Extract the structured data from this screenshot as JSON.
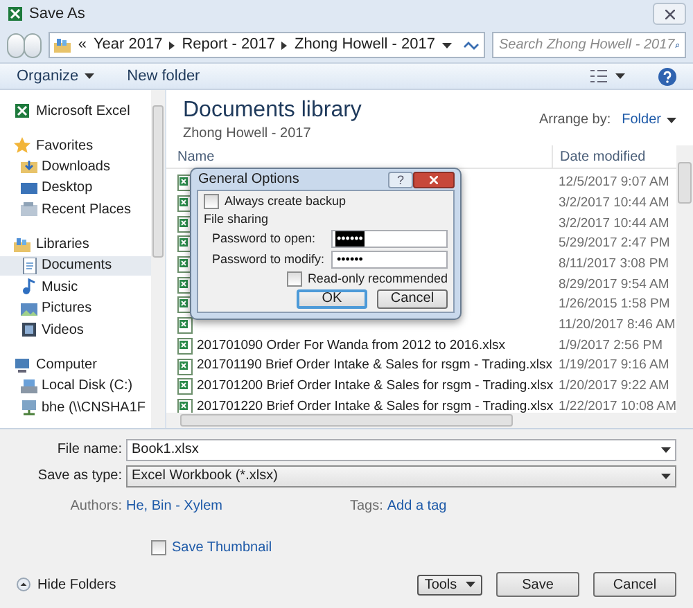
{
  "window": {
    "title": "Save As"
  },
  "address": {
    "prefix": "«",
    "path": [
      "Year 2017",
      "Report - 2017",
      "Zhong Howell - 2017"
    ]
  },
  "search": {
    "placeholder": "Search Zhong Howell - 2017"
  },
  "toolbar": {
    "buttons": [
      "Organize",
      "New folder"
    ]
  },
  "sidebar": {
    "items": [
      {
        "label": "Microsoft Excel",
        "selected": false
      },
      {
        "label": "Favorites",
        "selected": false,
        "children": [
          {
            "label": "Downloads",
            "selected": false
          },
          {
            "label": "Desktop",
            "selected": false
          },
          {
            "label": "Recent Places",
            "selected": false
          }
        ]
      },
      {
        "label": "Libraries",
        "selected": false,
        "children": [
          {
            "label": "Documents",
            "selected": true
          },
          {
            "label": "Music",
            "selected": false
          },
          {
            "label": "Pictures",
            "selected": false
          },
          {
            "label": "Videos",
            "selected": false
          }
        ]
      },
      {
        "label": "Computer",
        "selected": false,
        "children": [
          {
            "label": "Local Disk (C:)",
            "selected": false
          },
          {
            "label": "bhe (\\\\CNSHA1F",
            "selected": false
          }
        ]
      }
    ]
  },
  "library": {
    "title": "Documents library",
    "subtitle": "Zhong Howell - 2017",
    "arrange_label": "Arrange by:",
    "arrange_value": "Folder"
  },
  "table": {
    "columns": [
      "Name",
      "Date modified"
    ],
    "rows": [
      {
        "date": "12/5/2017 9:07 AM"
      },
      {
        "date": "3/2/2017 10:44 AM"
      },
      {
        "date": "3/2/2017 10:44 AM"
      },
      {
        "date": "5/29/2017 2:47 PM"
      },
      {
        "date": "8/11/2017 3:08 PM"
      },
      {
        "date": "8/29/2017 9:54 AM"
      },
      {
        "date": "1/26/2015 1:58 PM"
      },
      {
        "date": "11/20/2017 8:46 AM"
      },
      {
        "name": "201701090 Order For Wanda from 2012 to 2016.xlsx",
        "date": "1/9/2017 2:56 PM"
      },
      {
        "name": "201701190 Brief Order Intake & Sales for rsgm - Trading.xlsx",
        "date": "1/19/2017 9:16 AM"
      },
      {
        "name": "201701200 Brief Order Intake & Sales for rsgm - Trading.xlsx",
        "date": "1/20/2017 9:22 AM"
      },
      {
        "name": "201701220 Brief Order Intake & Sales for rsgm - Trading.xlsx",
        "date": "1/22/2017 10:08 AM"
      }
    ]
  },
  "dialog": {
    "title": "General Options",
    "help": "?",
    "backup": {
      "label": "Always create backup",
      "checked": false
    },
    "section": "File sharing",
    "fields": [
      {
        "label": "Password to open:",
        "value": "••••••",
        "selected": true
      },
      {
        "label": "Password to modify:",
        "value": "••••••",
        "selected": false
      }
    ],
    "readonly": {
      "label": "Read-only recommended",
      "checked": false
    },
    "buttons": [
      {
        "label": "OK",
        "default": true
      },
      {
        "label": "Cancel",
        "default": false
      }
    ]
  },
  "form": {
    "file_name": {
      "label": "File name:",
      "value": "Book1.xlsx"
    },
    "save_type": {
      "label": "Save as type:",
      "value": "Excel Workbook (*.xlsx)"
    },
    "authors": {
      "label": "Authors:",
      "value": "He, Bin - Xylem"
    },
    "tags": {
      "label": "Tags:",
      "value": "Add a tag"
    },
    "thumbnail": {
      "label": "Save Thumbnail",
      "checked": false
    }
  },
  "footer": {
    "hide_folders": "Hide Folders",
    "tools": "Tools",
    "buttons": [
      "Save",
      "Cancel"
    ]
  }
}
